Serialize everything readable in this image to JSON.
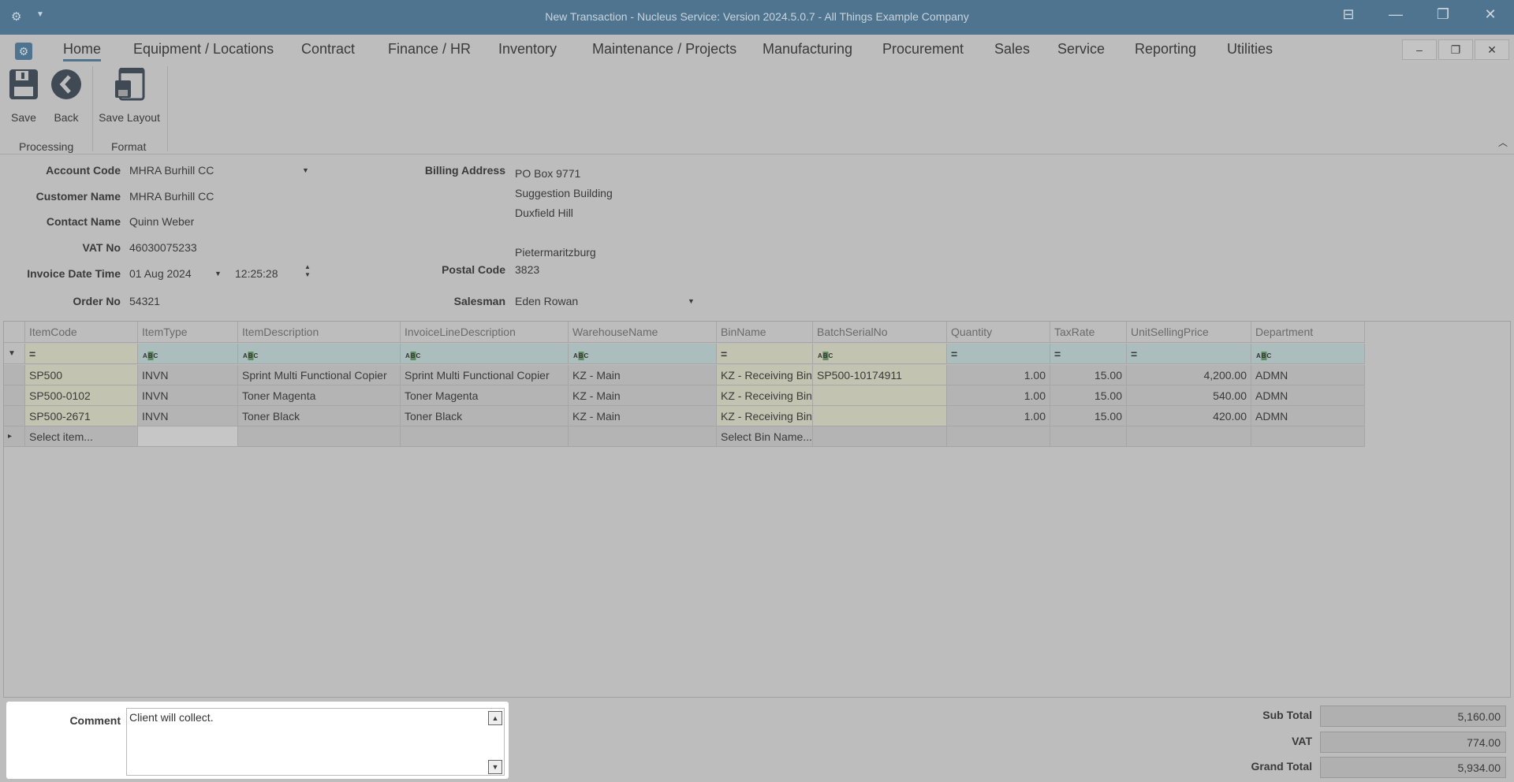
{
  "window": {
    "title": "New Transaction - Nucleus Service: Version 2024.5.0.7 - All Things Example Company"
  },
  "menu": {
    "tabs": [
      "Home",
      "Equipment / Locations",
      "Contract",
      "Finance / HR",
      "Inventory",
      "Maintenance / Projects",
      "Manufacturing",
      "Procurement",
      "Sales",
      "Service",
      "Reporting",
      "Utilities"
    ]
  },
  "ribbon": {
    "save": "Save",
    "back": "Back",
    "save_layout": "Save Layout",
    "group_processing": "Processing",
    "group_format": "Format"
  },
  "form": {
    "account_code_label": "Account Code",
    "account_code": "MHRA Burhill CC",
    "customer_name_label": "Customer Name",
    "customer_name": "MHRA Burhill CC",
    "contact_name_label": "Contact Name",
    "contact_name": "Quinn Weber",
    "vat_no_label": "VAT No",
    "vat_no": "46030075233",
    "invoice_datetime_label": "Invoice Date Time",
    "invoice_date": "01 Aug 2024",
    "invoice_time": "12:25:28",
    "order_no_label": "Order No",
    "order_no": "54321",
    "billing_address_label": "Billing Address",
    "billing_address": [
      "PO Box 9771",
      "Suggestion Building",
      "Duxfield Hill",
      "",
      "Pietermaritzburg"
    ],
    "postal_code_label": "Postal Code",
    "postal_code": "3823",
    "salesman_label": "Salesman",
    "salesman": "Eden Rowan"
  },
  "grid": {
    "columns": [
      "ItemCode",
      "ItemType",
      "ItemDescription",
      "InvoiceLineDescription",
      "WarehouseName",
      "BinName",
      "BatchSerialNo",
      "Quantity",
      "TaxRate",
      "UnitSellingPrice",
      "Department"
    ],
    "filter_ops": [
      "=",
      "ABC",
      "ABC",
      "ABC",
      "ABC",
      "=",
      "ABC",
      "=",
      "=",
      "=",
      "ABC"
    ],
    "rows": [
      [
        "SP500",
        "INVN",
        "Sprint Multi Functional Copier",
        "Sprint Multi Functional Copier",
        "KZ - Main",
        "KZ - Receiving Bin",
        "SP500-10174911",
        "1.00",
        "15.00",
        "4,200.00",
        "ADMN"
      ],
      [
        "SP500-0102",
        "INVN",
        "Toner Magenta",
        "Toner Magenta",
        "KZ - Main",
        "KZ - Receiving Bin",
        "",
        "1.00",
        "15.00",
        "540.00",
        "ADMN"
      ],
      [
        "SP500-2671",
        "INVN",
        "Toner Black",
        "Toner Black",
        "KZ - Main",
        "KZ - Receiving Bin",
        "",
        "1.00",
        "15.00",
        "420.00",
        "ADMN"
      ]
    ],
    "new_row": {
      "item_placeholder": "Select item...",
      "bin_placeholder": "Select Bin Name..."
    }
  },
  "footer": {
    "comment_label": "Comment",
    "comment": "Client will collect.",
    "sub_total_label": "Sub Total",
    "sub_total": "5,160.00",
    "vat_label": "VAT",
    "vat": "774.00",
    "grand_total_label": "Grand Total",
    "grand_total": "5,934.00"
  }
}
